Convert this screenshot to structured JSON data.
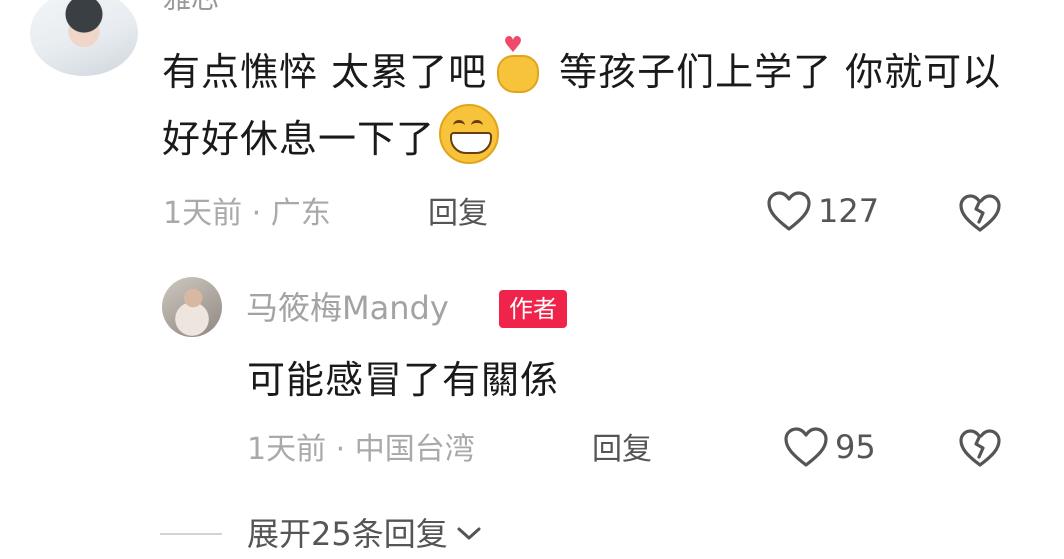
{
  "top_comment": {
    "username": "雅芯",
    "text_part1": "有点憔悴 太累了吧",
    "text_part2": "等孩子们上学了 你就可以好好休息一下了",
    "time_location": "1天前 · 广东",
    "reply_label": "回复",
    "like_count": "127"
  },
  "reply_comment": {
    "username": "马筱梅Mandy",
    "author_badge": "作者",
    "text": "可能感冒了有關係",
    "time_location": "1天前 · 中国台湾",
    "reply_label": "回复",
    "like_count": "95"
  },
  "expand": {
    "label": "展开25条回复"
  },
  "icons": {
    "like": "heart-outline-icon",
    "dislike": "broken-heart-icon",
    "expand": "chevron-down-icon"
  }
}
